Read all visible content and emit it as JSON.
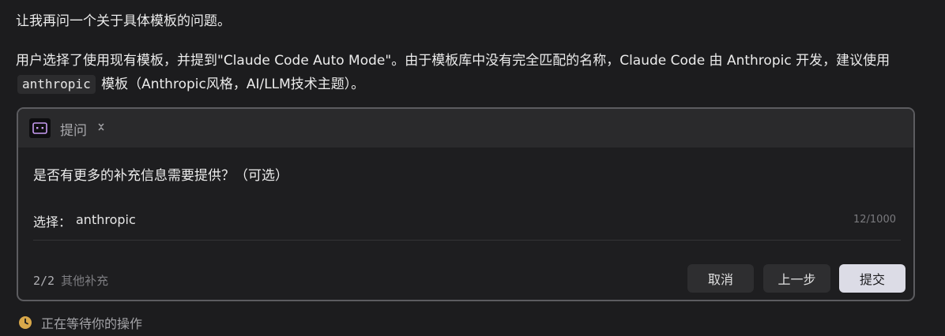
{
  "message": {
    "line1": "让我再问一个关于具体模板的问题。",
    "para_part1": "用户选择了使用现有模板，并提到\"Claude Code Auto Mode\"。由于模板库中没有完全匹配的名称，Claude Code 由 Anthropic 开发，建议使用",
    "code": "anthropic",
    "para_part2": "模板（Anthropic风格，AI/LLM技术主题）。"
  },
  "card": {
    "header_title": "提问",
    "header_icon": "robot-icon",
    "collapse_icon": "chevron-up-down-icon",
    "question": "是否有更多的补充信息需要提供？（可选）",
    "answer_label": "选择：",
    "answer_value": "anthropic",
    "counter": "12/1000",
    "progress_count": "2/2",
    "progress_label": "其他补充",
    "buttons": {
      "cancel": "取消",
      "prev": "上一步",
      "submit": "提交"
    }
  },
  "status": {
    "icon": "clock-icon",
    "text": "正在等待你的操作"
  },
  "colors": {
    "background": "#1c1c1e",
    "accent_icon": "#c79bf2",
    "status_icon": "#d9a84a",
    "submit_bg": "#dcdce6"
  }
}
